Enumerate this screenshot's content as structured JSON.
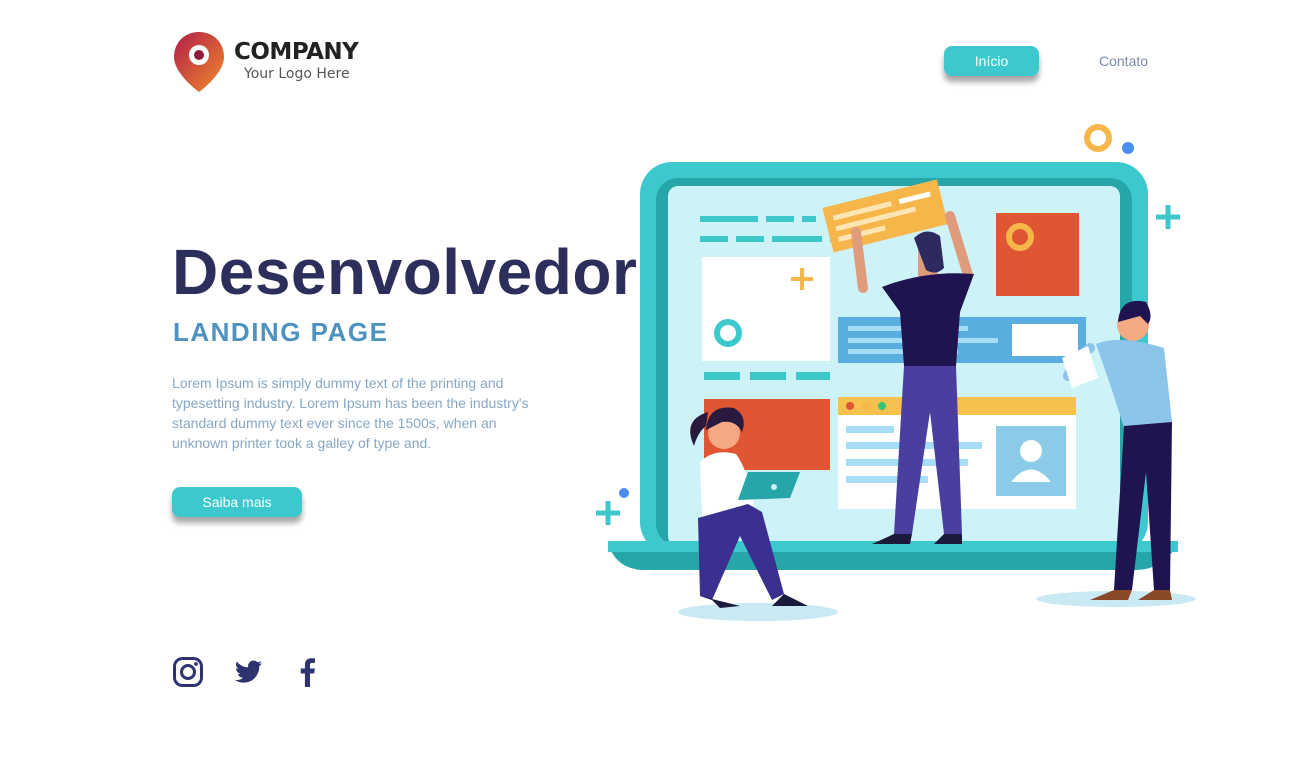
{
  "logo": {
    "name": "COMPANY",
    "tagline": "Your Logo Here"
  },
  "nav": {
    "primary_label": "Início",
    "secondary_label": "Contato"
  },
  "hero": {
    "title": "Desenvolvedor",
    "subtitle": "LANDING PAGE",
    "body": "Lorem Ipsum is simply dummy text of the printing and typesetting industry. Lorem Ipsum has been the industry's standard dummy text ever since the 1500s, when an unknown printer took a galley of type and.",
    "cta_label": "Saiba mais"
  },
  "social": [
    "instagram-icon",
    "twitter-icon",
    "facebook-icon"
  ],
  "colors": {
    "accent": "#3cc8cc",
    "title": "#2c2e5c",
    "subtitle": "#4e92c0",
    "body": "#86a7c4",
    "social": "#2d3470"
  }
}
